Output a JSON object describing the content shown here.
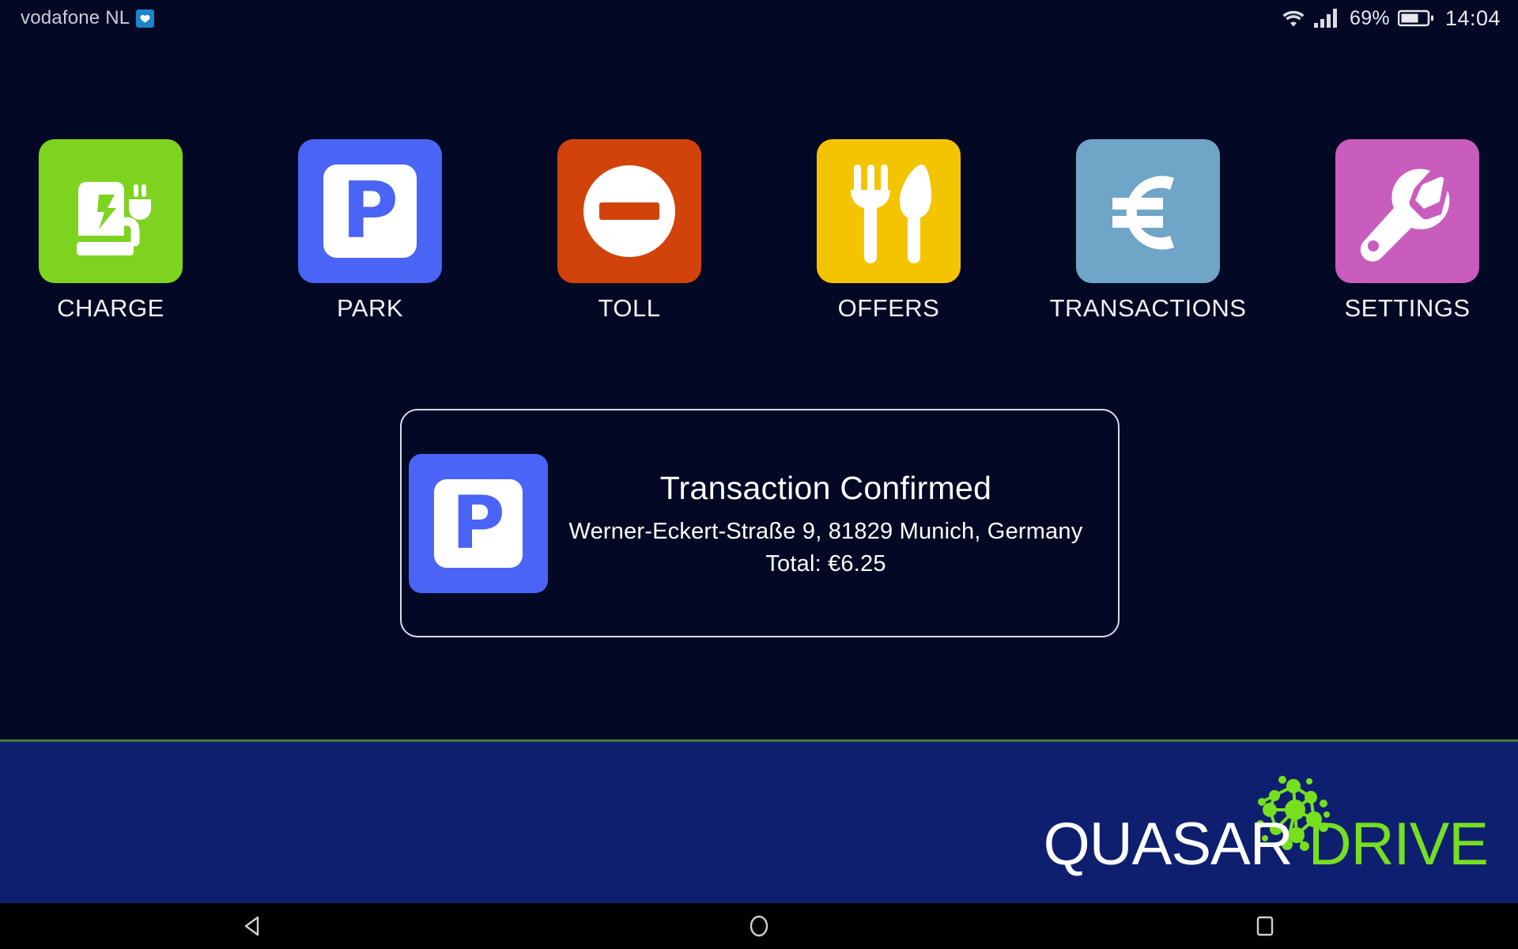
{
  "status_bar": {
    "carrier": "vodafone NL",
    "dual_sim_icon": "dual-sim-badge-icon",
    "wifi_icon": "wifi-icon",
    "signal_icon": "cellular-signal-icon",
    "battery_percent": "69%",
    "battery_icon": "battery-icon",
    "clock": "14:04"
  },
  "tiles": [
    {
      "id": "charge",
      "label": "CHARGE",
      "color": "#7ed321",
      "icon": "ev-charger-icon"
    },
    {
      "id": "park",
      "label": "PARK",
      "color": "#4a64f5",
      "icon": "parking-sign-icon"
    },
    {
      "id": "toll",
      "label": "TOLL",
      "color": "#d2430b",
      "icon": "no-entry-icon"
    },
    {
      "id": "offers",
      "label": "OFFERS",
      "color": "#f5c400",
      "icon": "fork-knife-icon"
    },
    {
      "id": "transactions",
      "label": "TRANSACTIONS",
      "color": "#6fa5c6",
      "icon": "euro-sign-icon"
    },
    {
      "id": "settings",
      "label": "SETTINGS",
      "color": "#c95dbd",
      "icon": "wrench-icon"
    }
  ],
  "transaction_card": {
    "icon": "parking-sign-icon",
    "title": "Transaction Confirmed",
    "address": "Werner-Eckert-Straße 9, 81829 Munich, Germany",
    "total": "Total: €6.25"
  },
  "footer": {
    "background_color": "#0e1f70",
    "rule_color": "#4a7a3c",
    "brand_primary": "QUASAR",
    "brand_secondary": "DRIVE",
    "brand_primary_color": "#ffffff",
    "brand_secondary_color": "#76df20",
    "cluster_icon": "molecule-cluster-icon"
  },
  "nav_bar": {
    "back": "back-triangle-icon",
    "home": "home-circle-icon",
    "recents": "recents-square-icon"
  },
  "theme": {
    "background": "#030925",
    "text": "#ffffff"
  }
}
